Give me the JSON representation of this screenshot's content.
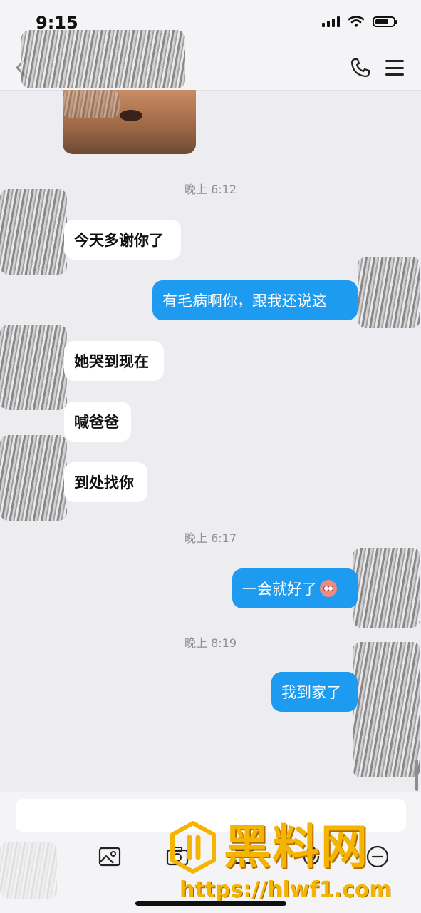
{
  "status_bar": {
    "time": "9:15"
  },
  "timestamps": [
    "晚上 6:12",
    "晚上 6:17",
    "晚上 8:19"
  ],
  "messages": [
    {
      "side": "in",
      "text": "今天多谢你了"
    },
    {
      "side": "out",
      "text": "有毛病啊你，跟我还说这"
    },
    {
      "side": "in",
      "text": "她哭到现在"
    },
    {
      "side": "in",
      "text": "喊爸爸"
    },
    {
      "side": "in",
      "text": "到处找你"
    },
    {
      "side": "out",
      "text": "一会就好了"
    },
    {
      "side": "out",
      "text": "我到家了"
    }
  ],
  "icons": {
    "back": "chevron-left-icon",
    "call": "phone-icon",
    "menu": "hamburger-menu-icon",
    "toolbar": [
      "image-icon",
      "camera-icon",
      "file-icon",
      "mic-icon",
      "more-icon"
    ]
  },
  "watermark": {
    "title": "黑料网",
    "url": "https://hlwf1.com"
  },
  "colors": {
    "outgoing_bubble": "#1d9bf0",
    "incoming_bubble": "#ffffff",
    "background": "#ededf1",
    "watermark": "#f4b400"
  }
}
